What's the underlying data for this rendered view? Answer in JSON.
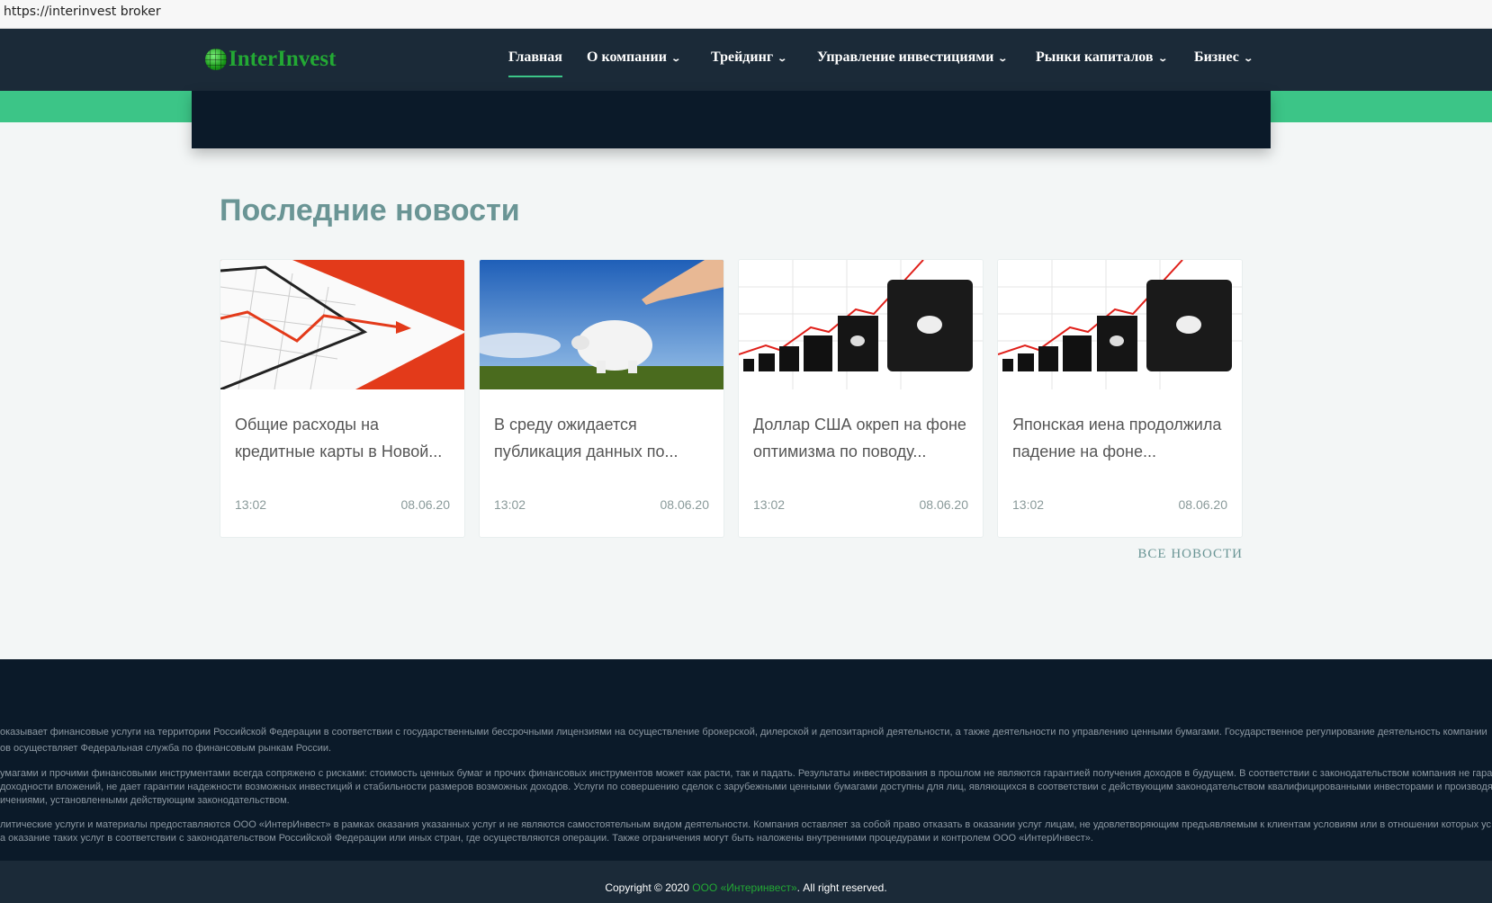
{
  "browser": {
    "url": "https://interinvest broker"
  },
  "logo": {
    "text": "InterInvest"
  },
  "nav": {
    "items": [
      {
        "label": "Главная",
        "dropdown": false,
        "active": true
      },
      {
        "label": "О компании",
        "dropdown": true
      },
      {
        "label": "Трейдинг",
        "dropdown": true
      },
      {
        "label": "Управление инвестициями",
        "dropdown": true
      },
      {
        "label": "Рынки капиталов",
        "dropdown": true
      },
      {
        "label": "Бизнес",
        "dropdown": true
      }
    ]
  },
  "news": {
    "title": "Последние новости",
    "cards": [
      {
        "title": "Общие расходы на кредитные карты в Новой...",
        "time": "13:02",
        "date": "08.06.20",
        "image": "falling-chart"
      },
      {
        "title": "В среду ожидается публикация данных по...",
        "time": "13:02",
        "date": "08.06.20",
        "image": "piggy-bank"
      },
      {
        "title": "Доллар США окреп на фоне оптимизма по поводу...",
        "time": "13:02",
        "date": "08.06.20",
        "image": "oil-barrels"
      },
      {
        "title": "Японская иена продолжила падение на фоне...",
        "time": "13:02",
        "date": "08.06.20",
        "image": "oil-barrels"
      }
    ],
    "all_link": "ВСЕ НОВОСТИ"
  },
  "footer": {
    "lines": [
      "оказывает финансовые услуги на территории Российской Федерации в соответствии с государственными бессрочными лицензиями на осуществление брокерской, дилерской и депозитарной деятельности, а также деятельности по управлению ценными бумагами. Государственное регулирование деятельность компании",
      "ов осуществляет Федеральная служба по финансовым рынкам России.",
      "умагами и прочими финансовыми инструментами всегда сопряжено с рисками: стоимость ценных бумаг и прочих финансовых инструментов может как расти, так и падать. Результаты инвестирования в прошлом не являются гарантией получения доходов в будущем. В соответствии с законодательством компания не гара",
      "доходности вложений, не дает гарантии надежности возможных инвестиций и стабильности размеров возможных доходов. Услуги по совершению сделок с зарубежными ценными бумагами доступны для лиц, являющихся в соответствии с действующим законодательством квалифицированными инвесторами и производят",
      "ичениями, установленными действующим законодательством.",
      "литические услуги и материалы предоставляются ООО «ИнтерИнвест» в рамках оказания указанных услуг и не являются самостоятельным видом деятельности. Компания оставляет за собой право отказать в оказании услуг лицам, не удовлетворяющим предъявляемым к клиентам условиям или в отношении которых ус",
      "а оказание таких услуг в соответствии с законодательством Российской Федерации или иных стран, где осуществляются операции. Также ограничения могут быть наложены внутренними процедурами и контролем ООО «ИнтерИнвест»."
    ],
    "copyright_prefix": "Copyright © 2020",
    "company_link": "ООО «Интеринвест»",
    "copyright_suffix": ". All right reserved."
  },
  "colors": {
    "accent": "#3cc587",
    "nav_bg": "#1b2a38",
    "footer_bg": "#0b1a29",
    "logo": "#23a834"
  }
}
